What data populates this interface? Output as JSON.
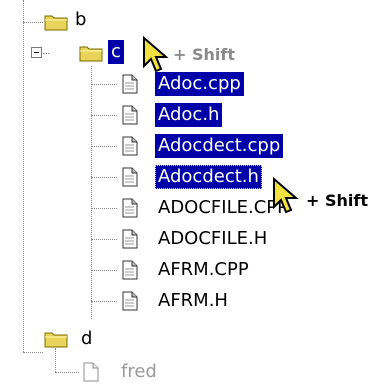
{
  "tree": {
    "folders": {
      "b": {
        "label": "b"
      },
      "c": {
        "label": "c"
      },
      "d": {
        "label": "d"
      }
    },
    "files": [
      {
        "label": "Adoc.cpp",
        "state": "selected"
      },
      {
        "label": "Adoc.h",
        "state": "selected"
      },
      {
        "label": "Adocdect.cpp",
        "state": "selected"
      },
      {
        "label": "Adocdect.h",
        "state": "focused"
      },
      {
        "label": "ADOCFILE.CPP",
        "state": "normal"
      },
      {
        "label": "ADOCFILE.H",
        "state": "normal"
      },
      {
        "label": "AFRM.CPP",
        "state": "normal"
      },
      {
        "label": "AFRM.H",
        "state": "normal"
      }
    ],
    "child_of_d": {
      "label": "fred"
    }
  },
  "annotations": {
    "shift_top": "+ Shift",
    "shift_right": "+ Shift"
  },
  "colors": {
    "selection": "#0000a8",
    "folder": "#e8d45a",
    "cursor": "#f0e040"
  }
}
